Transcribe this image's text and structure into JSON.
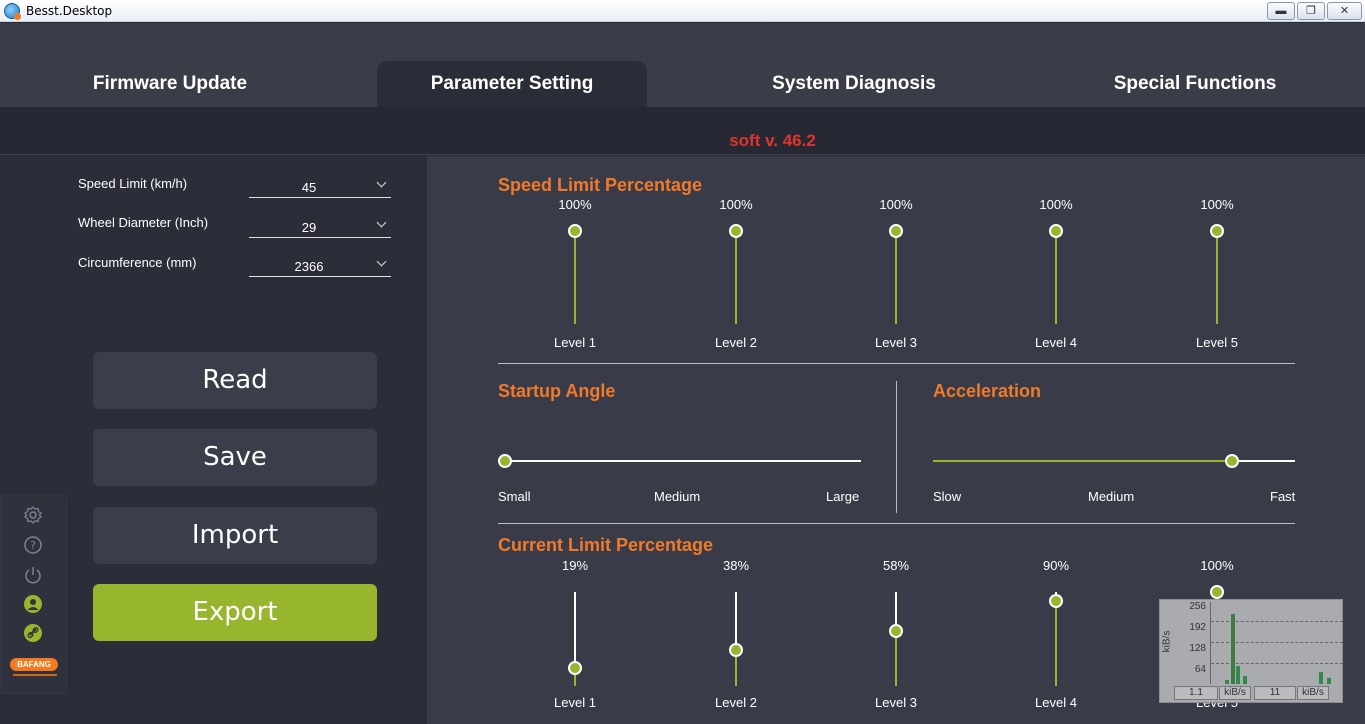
{
  "window": {
    "title": "Besst.Desktop",
    "min_glyph": "▬",
    "max_glyph": "❐",
    "close_glyph": "✕"
  },
  "tabs": [
    {
      "label": "Firmware Update",
      "active": false
    },
    {
      "label": "Parameter Setting",
      "active": true
    },
    {
      "label": "System Diagnosis",
      "active": false
    },
    {
      "label": "Special Functions",
      "active": false
    }
  ],
  "version": "soft v. 46.2",
  "fields": [
    {
      "label": "Speed Limit (km/h)",
      "value": "45"
    },
    {
      "label": "Wheel Diameter (Inch)",
      "value": "29"
    },
    {
      "label": "Circumference (mm)",
      "value": "2366"
    }
  ],
  "buttons": {
    "read": "Read",
    "save": "Save",
    "import": "Import",
    "export": "Export"
  },
  "sidebar": {
    "icons": [
      "settings-icon",
      "help-icon",
      "power-icon",
      "user-icon",
      "link-icon"
    ],
    "brand": "BAFANG"
  },
  "speed_limit": {
    "title": "Speed Limit Percentage",
    "levels": [
      {
        "label": "Level 1",
        "percent": "100%",
        "value": 1.0
      },
      {
        "label": "Level 2",
        "percent": "100%",
        "value": 1.0
      },
      {
        "label": "Level 3",
        "percent": "100%",
        "value": 1.0
      },
      {
        "label": "Level 4",
        "percent": "100%",
        "value": 1.0
      },
      {
        "label": "Level 5",
        "percent": "100%",
        "value": 1.0
      }
    ]
  },
  "startup_angle": {
    "title": "Startup Angle",
    "ticks": [
      "Small",
      "Medium",
      "Large"
    ],
    "value": 0.0
  },
  "acceleration": {
    "title": "Acceleration",
    "ticks": [
      "Slow",
      "Medium",
      "Fast"
    ],
    "value": 0.84
  },
  "current_limit": {
    "title": "Current Limit Percentage",
    "levels": [
      {
        "label": "Level 1",
        "percent": "19%",
        "value": 0.19
      },
      {
        "label": "Level 2",
        "percent": "38%",
        "value": 0.38
      },
      {
        "label": "Level 3",
        "percent": "58%",
        "value": 0.58
      },
      {
        "label": "Level 4",
        "percent": "90%",
        "value": 0.9
      },
      {
        "label": "Level 5",
        "percent": "100%",
        "value": 1.0
      }
    ]
  },
  "net_monitor": {
    "axis_label": "kiB/s",
    "ticks": [
      "256",
      "192",
      "128",
      "64"
    ],
    "down_value": "1.1",
    "down_unit": "kiB/s",
    "up_value": "11",
    "up_unit": "kiB/s"
  },
  "colors": {
    "accent_orange": "#f07a2a",
    "slider_green": "#98b52e",
    "version_red": "#e0322e",
    "brand_orange": "#f47a20"
  }
}
